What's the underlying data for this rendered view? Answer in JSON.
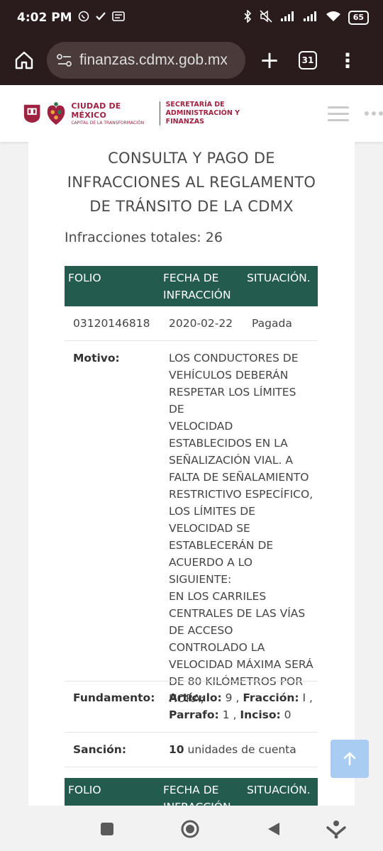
{
  "status_bar": {
    "time": "4:02 PM",
    "battery": "65",
    "left_icons": [
      "whatsapp-icon",
      "check-icon",
      "message-icon"
    ],
    "right_icons": [
      "bluetooth-icon",
      "mute-icon",
      "signal-icon",
      "signal-icon",
      "wifi-icon"
    ]
  },
  "browser": {
    "url": "finanzas.cdmx.gob.mx",
    "tab_count": "31",
    "plus_label": "+",
    "menu_label": "⋮"
  },
  "site_header": {
    "logo_city": "CIUDAD DE MÉXICO",
    "logo_sub": "CAPITAL DE LA TRANSFORMACIÓN",
    "dept_line1": "SECRETARÍA DE",
    "dept_line2": "ADMINISTRACIÓN Y FINANZAS"
  },
  "page": {
    "title_line1": "CONSULTA Y PAGO DE",
    "title_line2": "INFRACCIONES AL REGLAMENTO",
    "title_line3": "DE TRÁNSITO DE LA CDMX",
    "total_label": "Infracciones totales: 26"
  },
  "table": {
    "headers": {
      "folio": "FOLIO",
      "fecha_line1": "FECHA DE",
      "fecha_line2": "INFRACCIÓN",
      "situacion": "SITUACIÓN."
    },
    "row1": {
      "folio": "03120146818",
      "fecha": "2020-02-22",
      "situacion": "Pagada",
      "motivo_label": "Motivo:",
      "motivo_lines": [
        "LOS CONDUCTORES DE",
        "VEHÍCULOS DEBERÁN",
        "RESPETAR LOS LÍMITES DE",
        "VELOCIDAD",
        "ESTABLECIDOS EN LA",
        "SEÑALIZACIÓN VIAL. A",
        "FALTA DE SEÑALAMIENTO",
        "RESTRICTIVO ESPECÍFICO,",
        "LOS LÍMITES DE",
        "VELOCIDAD SE",
        "ESTABLECERÁN DE",
        "ACUERDO A LO SIGUIENTE:",
        "EN LOS CARRILES",
        "CENTRALES DE LAS VÍAS",
        "DE ACCESO",
        "CONTROLADO LA",
        "VELOCIDAD MÁXIMA SERÁ",
        "DE 80 KILÓMETROS POR",
        "HORA;"
      ],
      "fundamento_label": "Fundamento:",
      "articulo_label": "Artículo:",
      "articulo": " 9 , ",
      "fraccion_label": "Fracción:",
      "fraccion": " I ,",
      "parrafo_label": "Parrafo:",
      "parrafo": " 1 , ",
      "inciso_label": "Inciso:",
      "inciso": " 0",
      "sancion_label": "Sanción:",
      "sancion_value": "10",
      "sancion_unit": " unidades de cuenta"
    }
  },
  "colors": {
    "header_green": "#235b4e",
    "brand": "#9f2241",
    "browser_bg": "#2a1c1c",
    "scroll_button": "#a9cdf2"
  }
}
